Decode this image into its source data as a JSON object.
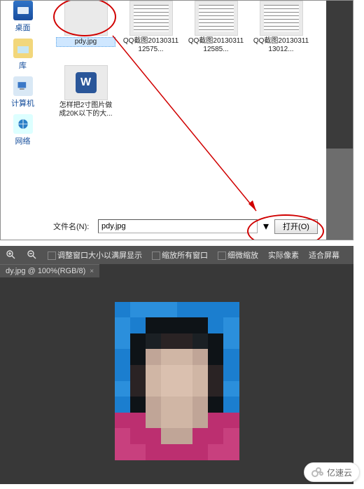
{
  "places": {
    "desktop": "桌面",
    "library": "库",
    "computer": "计算机",
    "network": "网络"
  },
  "files": {
    "pdy": "pdy.jpg",
    "qq1": "QQ截图2013031112575...",
    "qq2": "QQ截图2013031112585...",
    "qq3": "QQ截图2013031113012...",
    "doc": "怎样把2寸图片做成20K以下的大..."
  },
  "wordletter": "W",
  "dialog": {
    "filename_label": "文件名(N):",
    "filename_value": "pdy.jpg",
    "open_btn": "打开(O)"
  },
  "ps": {
    "opt1": "调整窗口大小以满屏显示",
    "opt2": "缩放所有窗口",
    "opt3": "细微缩放",
    "btn1": "实际像素",
    "btn2": "适合屏幕",
    "tab": "dy.jpg @ 100%(RGB/8)",
    "tab_close": "×"
  },
  "brand": "亿速云",
  "mosaic": [
    "#1a7dcf",
    "#2b8fdc",
    "#2b8fdc",
    "#2b8fdc",
    "#1a7dcf",
    "#1a7dcf",
    "#1a7dcf",
    "#1a7dcf",
    "#2b8fdc",
    "#1a7dcf",
    "#0d0d0d",
    "#0d0d0d",
    "#0d0d0d",
    "#0d0d0d",
    "#1a7dcf",
    "#2b8fdc",
    "#2b8fdc",
    "#0d0d0d",
    "#1a1a1a",
    "#2a1d1a",
    "#2a1d1a",
    "#1a1a1a",
    "#0d0d0d",
    "#2b8fdc",
    "#1a7dcf",
    "#0d0d0d",
    "#c8a793",
    "#d9b8a2",
    "#d9b8a2",
    "#c8a793",
    "#0d0d0d",
    "#1a7dcf",
    "#1a7dcf",
    "#2a1d1a",
    "#d9b8a2",
    "#e4c3ad",
    "#e4c3ad",
    "#d9b8a2",
    "#2a1d1a",
    "#1a7dcf",
    "#2b8fdc",
    "#2a1d1a",
    "#d9b8a2",
    "#e4c3ad",
    "#e4c3ad",
    "#d9b8a2",
    "#2a1d1a",
    "#2b8fdc",
    "#1a7dcf",
    "#0d0d0d",
    "#c8a793",
    "#d9b8a2",
    "#d9b8a2",
    "#c8a793",
    "#0d0d0d",
    "#1a7dcf",
    "#c42a6a",
    "#c42a6a",
    "#c8a793",
    "#d9b8a2",
    "#d9b8a2",
    "#c8a793",
    "#c42a6a",
    "#c42a6a",
    "#d13c79",
    "#c42a6a",
    "#c42a6a",
    "#c8a793",
    "#c8a793",
    "#c42a6a",
    "#c42a6a",
    "#d13c79",
    "#d13c79",
    "#d13c79",
    "#c42a6a",
    "#c42a6a",
    "#c42a6a",
    "#c42a6a",
    "#d13c79",
    "#d13c79"
  ]
}
